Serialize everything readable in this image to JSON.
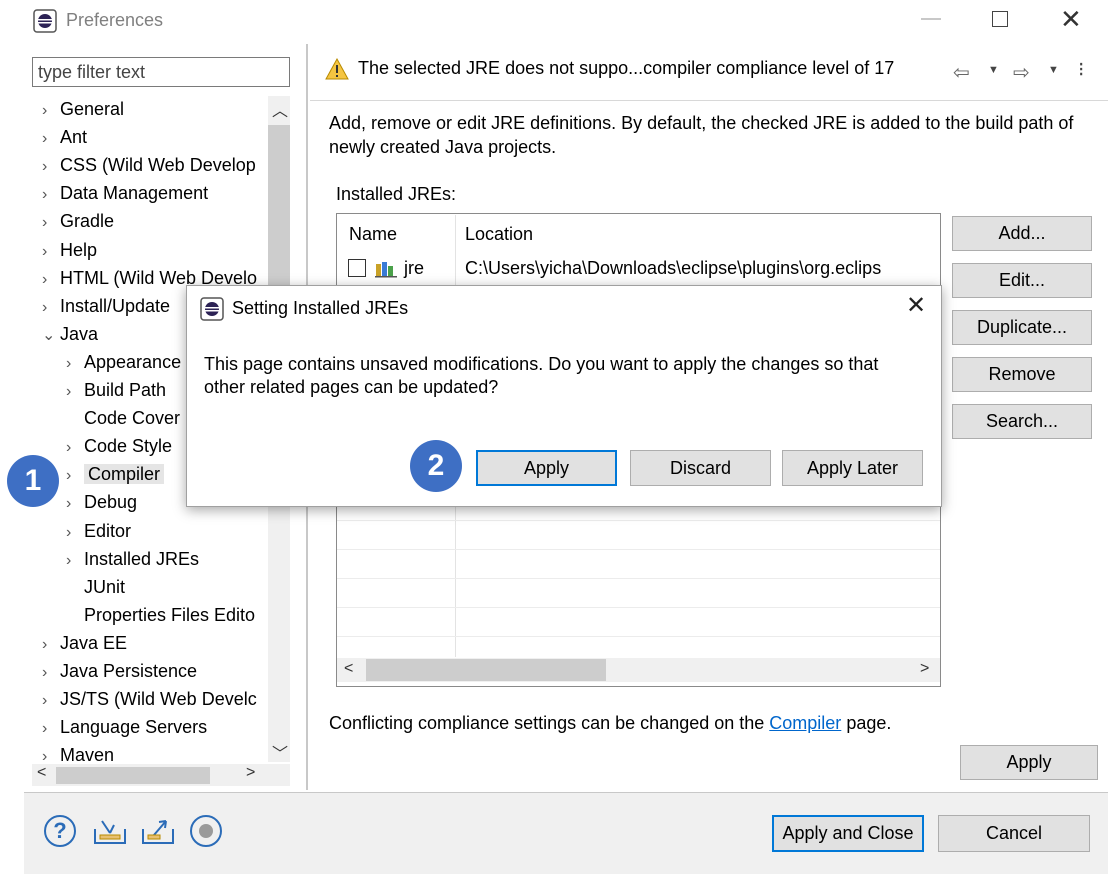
{
  "window": {
    "title": "Preferences"
  },
  "filter": {
    "placeholder": "type filter text"
  },
  "tree": {
    "items": [
      {
        "label": "General",
        "level": 0,
        "expander": "›"
      },
      {
        "label": "Ant",
        "level": 0,
        "expander": "›"
      },
      {
        "label": "CSS (Wild Web Develop",
        "level": 0,
        "expander": "›"
      },
      {
        "label": "Data Management",
        "level": 0,
        "expander": "›"
      },
      {
        "label": "Gradle",
        "level": 0,
        "expander": "›"
      },
      {
        "label": "Help",
        "level": 0,
        "expander": "›"
      },
      {
        "label": "HTML (Wild Web Develo",
        "level": 0,
        "expander": "›"
      },
      {
        "label": "Install/Update",
        "level": 0,
        "expander": "›"
      },
      {
        "label": "Java",
        "level": 0,
        "expander": "⌄"
      },
      {
        "label": "Appearance",
        "level": 1,
        "expander": "›"
      },
      {
        "label": "Build Path",
        "level": 1,
        "expander": "›"
      },
      {
        "label": "Code Cover",
        "level": 1,
        "expander": ""
      },
      {
        "label": "Code Style",
        "level": 1,
        "expander": "›"
      },
      {
        "label": "Compiler",
        "level": 1,
        "expander": "›",
        "selected": true
      },
      {
        "label": "Debug",
        "level": 1,
        "expander": "›"
      },
      {
        "label": "Editor",
        "level": 1,
        "expander": "›"
      },
      {
        "label": "Installed JREs",
        "level": 1,
        "expander": "›"
      },
      {
        "label": "JUnit",
        "level": 1,
        "expander": ""
      },
      {
        "label": "Properties Files Edito",
        "level": 1,
        "expander": ""
      },
      {
        "label": "Java EE",
        "level": 0,
        "expander": "›"
      },
      {
        "label": "Java Persistence",
        "level": 0,
        "expander": "›"
      },
      {
        "label": "JS/TS (Wild Web Develc",
        "level": 0,
        "expander": "›"
      },
      {
        "label": "Language Servers",
        "level": 0,
        "expander": "›"
      },
      {
        "label": "Maven",
        "level": 0,
        "expander": "›"
      }
    ]
  },
  "header": {
    "message": "The selected JRE does not suppo...compiler compliance level of 17"
  },
  "page": {
    "description": "Add, remove or edit JRE definitions. By default, the checked JRE is added to the build path of newly created Java projects.",
    "installed_label": "Installed JREs:",
    "columns": {
      "name": "Name",
      "location": "Location"
    },
    "jre_row": {
      "name": "jre",
      "location": "C:\\Users\\yicha\\Downloads\\eclipse\\plugins\\org.eclips",
      "checked": false
    },
    "buttons": {
      "add": "Add...",
      "edit": "Edit...",
      "duplicate": "Duplicate...",
      "remove": "Remove",
      "search": "Search..."
    },
    "conflict_prefix": "Conflicting compliance settings can be changed on the ",
    "conflict_link": "Compiler",
    "conflict_suffix": " page.",
    "apply": "Apply"
  },
  "footer": {
    "apply_close": "Apply and Close",
    "cancel": "Cancel"
  },
  "dialog": {
    "title": "Setting Installed JREs",
    "message": "This page contains unsaved modifications. Do you want to apply the changes so that other related pages can be updated?",
    "buttons": {
      "apply": "Apply",
      "discard": "Discard",
      "apply_later": "Apply Later"
    }
  },
  "callouts": {
    "one": "1",
    "two": "2"
  },
  "colors": {
    "accent": "#0078d7",
    "callout": "#3e6fc4",
    "link": "#0066cc"
  }
}
